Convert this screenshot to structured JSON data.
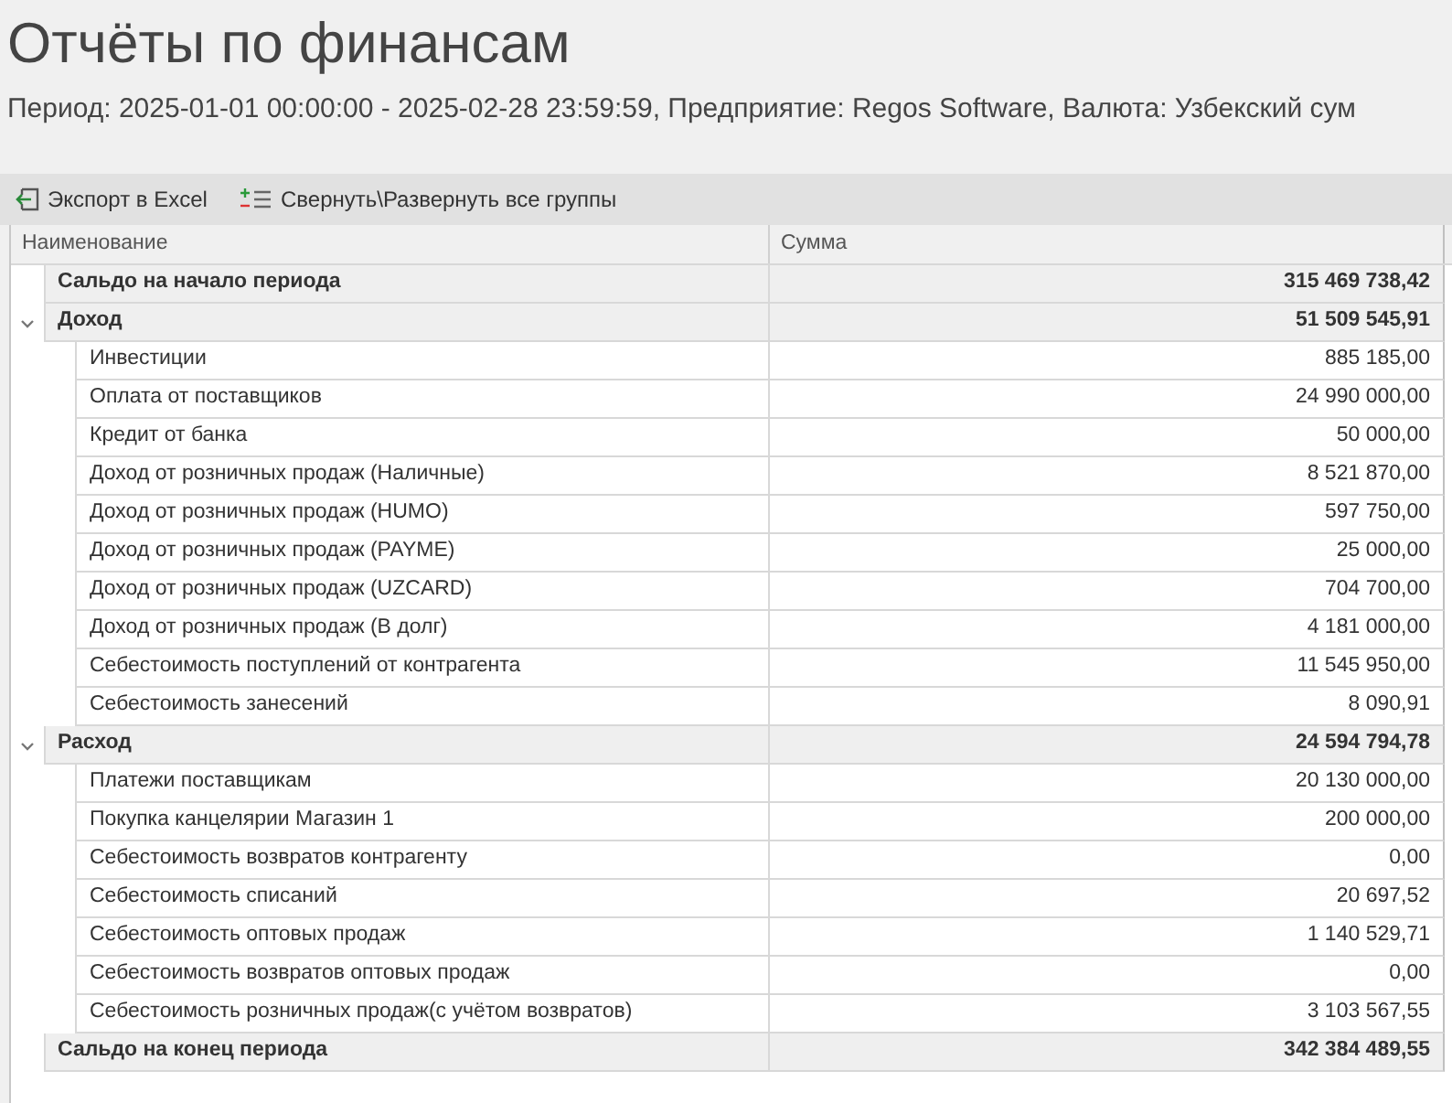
{
  "title": "Отчёты по финансам",
  "subtitle": "Период: 2025-01-01 00:00:00 - 2025-02-28 23:59:59, Предприятие: Regos Software, Валюта: Узбекский сум",
  "toolbar": [
    {
      "kind": "export",
      "label": "Экспорт в Excel"
    },
    {
      "kind": "toggle",
      "label": "Свернуть\\Развернуть все группы"
    }
  ],
  "table": {
    "columns": [
      "Наименование",
      "Сумма"
    ],
    "rows": [
      {
        "kind": "total",
        "name": "Сальдо на начало периода",
        "amount": "315 469 738,42"
      },
      {
        "kind": "group",
        "name": "Доход",
        "amount": "51 509 545,91",
        "expanded": true,
        "children": [
          {
            "name": "Инвестиции",
            "amount": "885 185,00"
          },
          {
            "name": "Оплата от поставщиков",
            "amount": "24 990 000,00"
          },
          {
            "name": "Кредит от банка",
            "amount": "50 000,00"
          },
          {
            "name": "Доход от розничных продаж (Наличные)",
            "amount": "8 521 870,00"
          },
          {
            "name": "Доход от розничных продаж (HUMO)",
            "amount": "597 750,00"
          },
          {
            "name": "Доход от розничных продаж (PAYME)",
            "amount": "25 000,00"
          },
          {
            "name": "Доход от розничных продаж (UZCARD)",
            "amount": "704 700,00"
          },
          {
            "name": "Доход от розничных продаж (В долг)",
            "amount": "4 181 000,00"
          },
          {
            "name": "Себестоимость поступлений от контрагента",
            "amount": "11 545 950,00"
          },
          {
            "name": "Себестоимость занесений",
            "amount": "8 090,91"
          }
        ]
      },
      {
        "kind": "group",
        "name": "Расход",
        "amount": "24 594 794,78",
        "expanded": true,
        "children": [
          {
            "name": "Платежи поставщикам",
            "amount": "20 130 000,00"
          },
          {
            "name": "Покупка канцелярии Магазин 1",
            "amount": "200 000,00"
          },
          {
            "name": "Себестоимость возвратов контрагенту",
            "amount": "0,00"
          },
          {
            "name": "Себестоимость списаний",
            "amount": "20 697,52"
          },
          {
            "name": "Себестоимость оптовых продаж",
            "amount": "1 140 529,71"
          },
          {
            "name": "Себестоимость возвратов оптовых продаж",
            "amount": "0,00"
          },
          {
            "name": "Себестоимость розничных продаж(с учётом возвратов)",
            "amount": "3 103 567,55"
          }
        ]
      },
      {
        "kind": "total",
        "name": "Сальдо на конец периода",
        "amount": "342 384 489,55"
      }
    ]
  }
}
